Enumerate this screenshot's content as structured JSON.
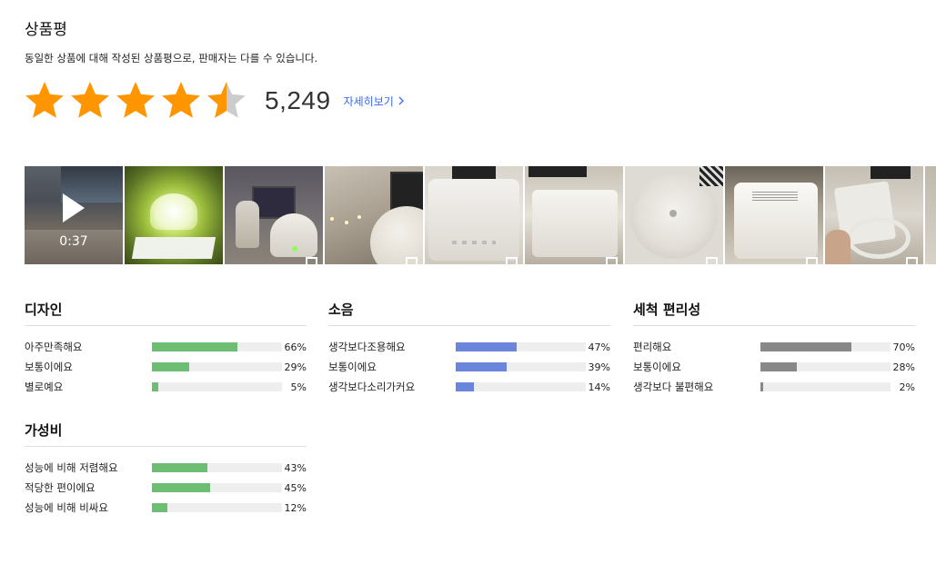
{
  "header": {
    "title": "상품평",
    "notice": "동일한 상품에 대해 작성된 상품평으로, 판매자는 다를 수 있습니다."
  },
  "rating": {
    "stars": 4.5,
    "max": 5,
    "review_count": "5,249",
    "details_link": "자세히보기",
    "chevron_icon": "chevron-right-icon"
  },
  "photos": {
    "video_duration": "0:37",
    "items": [
      {
        "type": "video"
      },
      {
        "type": "photo"
      },
      {
        "type": "photo"
      },
      {
        "type": "photo"
      },
      {
        "type": "photo"
      },
      {
        "type": "photo"
      },
      {
        "type": "photo"
      },
      {
        "type": "photo"
      },
      {
        "type": "photo"
      },
      {
        "type": "photo"
      }
    ]
  },
  "colors": {
    "star": "#ff9600",
    "star_empty": "#cccccc",
    "link": "#346aff",
    "bar_green": "#6dbd72",
    "bar_blue": "#6a86dc",
    "bar_gray": "#888888",
    "bar_track": "#eeeeee"
  },
  "sections": {
    "design": {
      "title": "디자인",
      "rows": [
        {
          "label": "아주만족해요",
          "percent": 66,
          "pct_text": "66%"
        },
        {
          "label": "보통이에요",
          "percent": 29,
          "pct_text": "29%"
        },
        {
          "label": "별로예요",
          "percent": 5,
          "pct_text": "5%"
        }
      ]
    },
    "noise": {
      "title": "소음",
      "rows": [
        {
          "label": "생각보다조용해요",
          "percent": 47,
          "pct_text": "47%"
        },
        {
          "label": "보통이에요",
          "percent": 39,
          "pct_text": "39%"
        },
        {
          "label": "생각보다소리가커요",
          "percent": 14,
          "pct_text": "14%"
        }
      ]
    },
    "cleaning": {
      "title": "세척 편리성",
      "rows": [
        {
          "label": "편리해요",
          "percent": 70,
          "pct_text": "70%"
        },
        {
          "label": "보통이에요",
          "percent": 28,
          "pct_text": "28%"
        },
        {
          "label": "생각보다 불편해요",
          "percent": 2,
          "pct_text": "2%"
        }
      ]
    },
    "value": {
      "title": "가성비",
      "rows": [
        {
          "label": "성능에 비해 저렴해요",
          "percent": 43,
          "pct_text": "43%"
        },
        {
          "label": "적당한 편이에요",
          "percent": 45,
          "pct_text": "45%"
        },
        {
          "label": "성능에 비해 비싸요",
          "percent": 12,
          "pct_text": "12%"
        }
      ]
    }
  }
}
